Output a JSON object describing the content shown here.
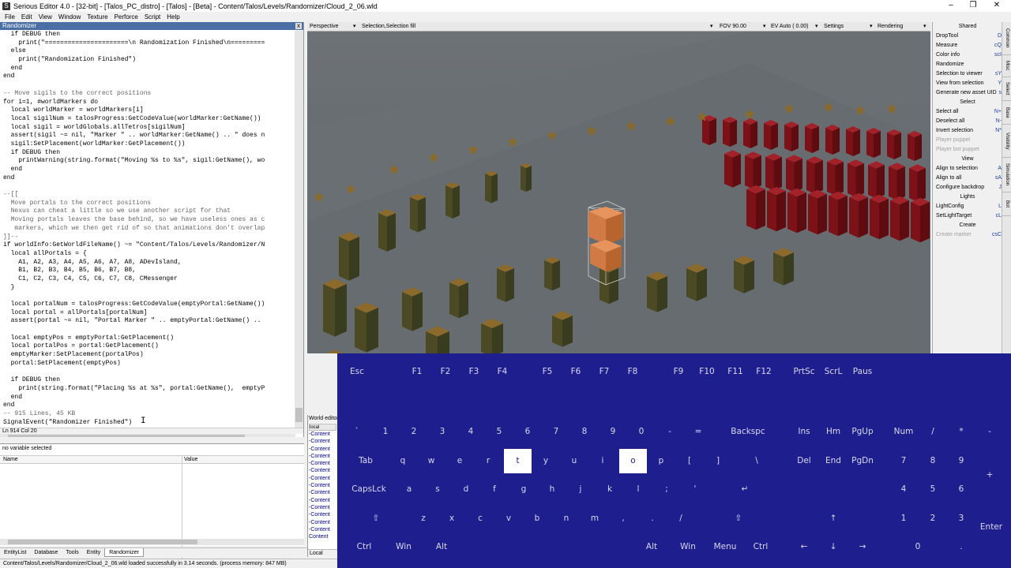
{
  "window": {
    "title": "Serious Editor 4.0 - [32-bit] - [Talos_PC_distro] - [Talos] - [Beta] - Content/Talos/Levels/Randomizer/Cloud_2_06.wld",
    "controls": [
      "–",
      "❐",
      "✕"
    ]
  },
  "menu": [
    "File",
    "Edit",
    "View",
    "Window",
    "Texture",
    "Perforce",
    "Script",
    "Help"
  ],
  "code_panel": {
    "title": "Randomizer",
    "close_label": "x",
    "lines": [
      "  if DEBUG then",
      "    print(\"======================\\n Randomization Finished\\n=========",
      "  else",
      "    print(\"Randomization Finished\")",
      "  end",
      "end",
      "",
      "-- Move sigils to the correct positions",
      "for i=1, #worldMarkers do",
      "  local worldMarker = worldMarkers[i]",
      "  local sigilNum = talosProgress:GetCodeValue(worldMarker:GetName())",
      "  local sigil = worldGlobals.allTetros[sigilNum]",
      "  assert(sigil ~= nil, \"Marker \" .. worldMarker:GetName() .. \" does n",
      "  sigil:SetPlacement(worldMarker:GetPlacement())",
      "  if DEBUG then",
      "    printWarning(string.format(\"Moving %s to %s\", sigil:GetName(), wo",
      "  end",
      "end",
      "",
      "--[[",
      "  Move portals to the correct positions",
      "  Nexus can cheat a little so we use another script for that",
      "  Moving portals leaves the base behind, so we have useless ones as c",
      "   markers, which we then get rid of so that animations don't overlap",
      "]]--",
      "if worldInfo:GetWorldFileName() ~= \"Content/Talos/Levels/Randomizer/N",
      "  local allPortals = {",
      "    A1, A2, A3, A4, A5, A6, A7, A8, ADevIsland,",
      "    B1, B2, B3, B4, B5, B6, B7, B8,",
      "    C1, C2, C3, C4, C5, C6, C7, C8, CMessenger",
      "  }",
      "",
      "  local portalNum = talosProgress:GetCodeValue(emptyPortal:GetName())",
      "  local portal = allPortals[portalNum]",
      "  assert(portal ~= nil, \"Portal Marker \" .. emptyPortal:GetName() ..",
      "",
      "  local emptyPos = emptyPortal:GetPlacement()",
      "  local portalPos = portal:GetPlacement()",
      "  emptyMarker:SetPlacement(portalPos)",
      "  portal:SetPlacement(emptyPos)",
      "",
      "  if DEBUG then",
      "    print(string.format(\"Placing %s at %s\", portal:GetName(),  emptyP",
      "  end",
      "end",
      "-- 915 Lines, 45 KB",
      "SignalEvent(\"Randomizer Finished\")"
    ],
    "status": "Ln 914  Col 20",
    "cursor_glyph": "I"
  },
  "variables": {
    "status": "no variable selected",
    "col_name": "Name",
    "col_value": "Value"
  },
  "bottom_tabs": [
    "EntityList",
    "Database",
    "Tools",
    "Entity",
    "Randomizer"
  ],
  "world_panel": {
    "title": "World editor",
    "sub": "local",
    "item": "-Content",
    "item_count": 14,
    "last_item": "Content",
    "footer": "Local"
  },
  "viewport": {
    "perspective": "Perspective",
    "selection": "Selection,Selection fill",
    "fov": "FOV 90.00",
    "ev": "EV Auto ( 0.00)",
    "settings": "Settings",
    "rendering": "Rendering",
    "dropdown_glyph": "▾"
  },
  "right_panel": {
    "sections": [
      {
        "title": "Shared",
        "items": [
          {
            "label": "DropTool",
            "sc": "D"
          },
          {
            "label": "Measure",
            "sc": "cQ"
          },
          {
            "label": "Color info",
            "sc": "scI"
          },
          {
            "label": "Randomize",
            "sc": ""
          },
          {
            "label": "Selection to viewer",
            "sc": "sY"
          },
          {
            "label": "View from selection",
            "sc": "Y"
          },
          {
            "label": "Generate new asset UID",
            "sc": "s"
          }
        ]
      },
      {
        "title": "Select",
        "items": [
          {
            "label": "Select all",
            "sc": "N+"
          },
          {
            "label": "Deselect all",
            "sc": "N-"
          },
          {
            "label": "Invert selection",
            "sc": "N*"
          },
          {
            "label": "Player puppet",
            "sc": "",
            "disabled": true
          },
          {
            "label": "Player bot puppet",
            "sc": "",
            "disabled": true
          }
        ]
      },
      {
        "title": "View",
        "items": [
          {
            "label": "Align to selection",
            "sc": "A"
          },
          {
            "label": "Align to all",
            "sc": "sA"
          },
          {
            "label": "Configure backdrop",
            "sc": "J"
          }
        ]
      },
      {
        "title": "Lights",
        "items": [
          {
            "label": "LightConfig",
            "sc": "L"
          },
          {
            "label": "SetLightTarget",
            "sc": "cL"
          }
        ]
      },
      {
        "title": "Create",
        "items": [
          {
            "label": "Create marker",
            "sc": "csC",
            "disabled": true
          }
        ]
      }
    ],
    "vtabs": [
      "Common",
      "Misc",
      "Select",
      "Base",
      "Visibility",
      "Simulation",
      "Bot"
    ]
  },
  "keyboard": {
    "highlight_color": "#ffffff",
    "bg_color": "#1e1e8e",
    "rows": [
      [
        "Esc",
        "F1",
        "F2",
        "F3",
        "F4",
        "F5",
        "F6",
        "F7",
        "F8",
        "F9",
        "F10",
        "F11",
        "F12",
        "PrtSc",
        "ScrL",
        "Paus"
      ],
      [
        "`",
        "1",
        "2",
        "3",
        "4",
        "5",
        "6",
        "7",
        "8",
        "9",
        "0",
        "-",
        "=",
        "Backspc",
        "Ins",
        "Hm",
        "PgUp",
        "Num",
        "/",
        "*",
        "-"
      ],
      [
        "Tab",
        "q",
        "w",
        "e",
        "r",
        "t",
        "y",
        "u",
        "i",
        "o",
        "p",
        "[",
        "]",
        "\\",
        "Del",
        "End",
        "PgDn",
        "7",
        "8",
        "9",
        "+"
      ],
      [
        "CapsLck",
        "a",
        "s",
        "d",
        "f",
        "g",
        "h",
        "j",
        "k",
        "l",
        ";",
        "'",
        "↵",
        "4",
        "5",
        "6"
      ],
      [
        "⇧",
        "z",
        "x",
        "c",
        "v",
        "b",
        "n",
        "m",
        ",",
        ".",
        "/",
        "⇧",
        "↑",
        "1",
        "2",
        "3",
        "Enter"
      ],
      [
        "Ctrl",
        "Win",
        "Alt",
        "",
        "Alt",
        "Win",
        "Menu",
        "Ctrl",
        "←",
        "↓",
        "→",
        "0",
        "."
      ]
    ],
    "highlighted": [
      "t",
      "o"
    ]
  },
  "statusbar": "Content/Talos/Levels/Randomizer/Cloud_2_06.wld loaded successfully in 3.14 seconds. (process memory: 847 MB)"
}
